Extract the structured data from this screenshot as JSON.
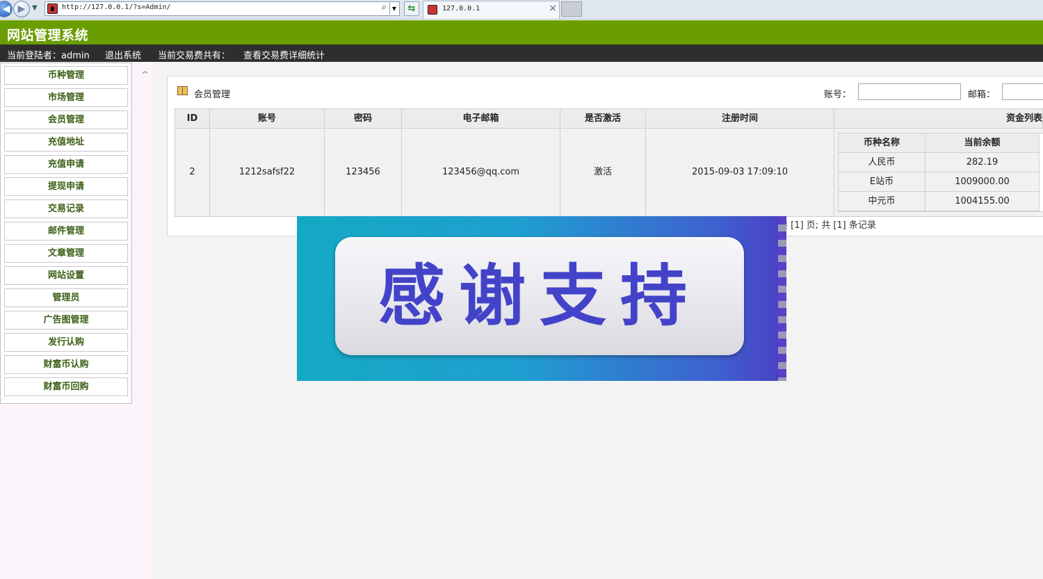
{
  "browser": {
    "url": "http://127.0.0.1/?s=Admin/",
    "tab_title": "127.0.0.1"
  },
  "app": {
    "title": "网站管理系统"
  },
  "top_menu": {
    "user": "当前登陆者：admin",
    "logout": "退出系统",
    "fee": "当前交易费共有：",
    "fee_stats": "查看交易费详细统计"
  },
  "sidebar": {
    "items": [
      {
        "label": "币种管理"
      },
      {
        "label": "市场管理"
      },
      {
        "label": "会员管理"
      },
      {
        "label": "充值地址"
      },
      {
        "label": "充值申请"
      },
      {
        "label": "提现申请"
      },
      {
        "label": "交易记录"
      },
      {
        "label": "邮件管理"
      },
      {
        "label": "文章管理"
      },
      {
        "label": "网站设置"
      },
      {
        "label": "管理员"
      },
      {
        "label": "广告图管理"
      },
      {
        "label": "发行认购"
      },
      {
        "label": "财富币认购"
      },
      {
        "label": "财富币回购"
      }
    ]
  },
  "panel": {
    "title": "会员管理",
    "account_label": "账号：",
    "email_label": "邮箱："
  },
  "table": {
    "headers": [
      "ID",
      "账号",
      "密码",
      "电子邮箱",
      "是否激活",
      "注册时间",
      "资金列表"
    ],
    "row": {
      "id": "2",
      "account": "1212safsf22",
      "password": "123456",
      "email": "123456@qq.com",
      "active": "激活",
      "reg_time": "2015-09-03 17:09:10"
    },
    "fund_headers": [
      "币种名称",
      "当前余额"
    ],
    "funds": [
      {
        "name": "人民币",
        "balance": "282.19"
      },
      {
        "name": "E站币",
        "balance": "1009000.00"
      },
      {
        "name": "中元币",
        "balance": "1004155.00"
      }
    ]
  },
  "pager": "共 [1] 页; 共 [1] 条记录",
  "banner": {
    "text": "感谢支持"
  },
  "colors": {
    "header_green": "#6a9d00",
    "menu_dark": "#2e2e2e",
    "sidebar_text": "#3b5f15",
    "banner_text": "#4343c9"
  }
}
